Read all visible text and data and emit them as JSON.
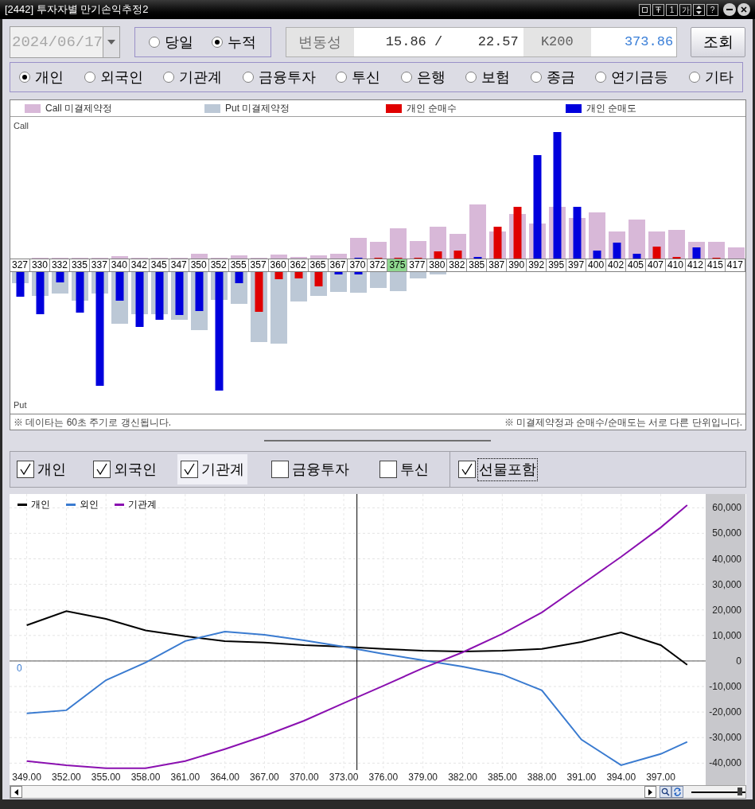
{
  "window": {
    "title": "[2442] 투자자별 만기손익추정2",
    "title_buttons": [
      "1",
      "가",
      "?"
    ]
  },
  "query": {
    "date": {
      "value": "2024/06/17",
      "disabled": true
    },
    "period_options": [
      {
        "label": "당일",
        "selected": false
      },
      {
        "label": "누적",
        "selected": true
      }
    ],
    "volatility_label": "변동성",
    "volatility_value_1": "15.86 /",
    "volatility_value_2": "22.57",
    "index_label": "K200",
    "index_value": "373.86",
    "search_button": "조회"
  },
  "investors": [
    {
      "label": "개인",
      "selected": true
    },
    {
      "label": "외국인",
      "selected": false
    },
    {
      "label": "기관계",
      "selected": false
    },
    {
      "label": "금융투자",
      "selected": false
    },
    {
      "label": "투신",
      "selected": false
    },
    {
      "label": "은행",
      "selected": false
    },
    {
      "label": "보험",
      "selected": false
    },
    {
      "label": "종금",
      "selected": false
    },
    {
      "label": "연기금등",
      "selected": false
    },
    {
      "label": "기타",
      "selected": false
    }
  ],
  "option_chart": {
    "legend": [
      {
        "label": "Call 미결제약정",
        "color": "#d8b8d8"
      },
      {
        "label": "Put 미결제약정",
        "color": "#bcc8d6"
      },
      {
        "label": "개인 순매수",
        "color": "#e00000"
      },
      {
        "label": "개인 순매도",
        "color": "#0000dd"
      }
    ],
    "call_label": "Call",
    "put_label": "Put",
    "strikes": [
      {
        "label": "327",
        "selected": false
      },
      {
        "label": "330",
        "selected": false
      },
      {
        "label": "332",
        "selected": false
      },
      {
        "label": "335",
        "selected": false
      },
      {
        "label": "337",
        "selected": false
      },
      {
        "label": "340",
        "selected": false
      },
      {
        "label": "342",
        "selected": false
      },
      {
        "label": "345",
        "selected": false
      },
      {
        "label": "347",
        "selected": false
      },
      {
        "label": "350",
        "selected": false
      },
      {
        "label": "352",
        "selected": false
      },
      {
        "label": "355",
        "selected": false
      },
      {
        "label": "357",
        "selected": false
      },
      {
        "label": "360",
        "selected": false
      },
      {
        "label": "362",
        "selected": false
      },
      {
        "label": "365",
        "selected": false
      },
      {
        "label": "367",
        "selected": false
      },
      {
        "label": "370",
        "selected": false
      },
      {
        "label": "372",
        "selected": false
      },
      {
        "label": "375",
        "selected": true
      },
      {
        "label": "377",
        "selected": false
      },
      {
        "label": "380",
        "selected": false
      },
      {
        "label": "382",
        "selected": false
      },
      {
        "label": "385",
        "selected": false
      },
      {
        "label": "387",
        "selected": false
      },
      {
        "label": "390",
        "selected": false
      },
      {
        "label": "392",
        "selected": false
      },
      {
        "label": "395",
        "selected": false
      },
      {
        "label": "397",
        "selected": false
      },
      {
        "label": "400",
        "selected": false
      },
      {
        "label": "402",
        "selected": false
      },
      {
        "label": "405",
        "selected": false
      },
      {
        "label": "407",
        "selected": false
      },
      {
        "label": "410",
        "selected": false
      },
      {
        "label": "412",
        "selected": false
      },
      {
        "label": "415",
        "selected": false
      },
      {
        "label": "417",
        "selected": false
      }
    ],
    "note_left": "※ 데이타는 60초 주기로 갱신됩니다.",
    "note_right": "※ 미결제약정과 순매수/순매도는 서로 다른 단위입니다."
  },
  "series_toggles": [
    {
      "label": "개인",
      "checked": true,
      "highlighted": false
    },
    {
      "label": "외국인",
      "checked": true,
      "highlighted": false
    },
    {
      "label": "기관계",
      "checked": true,
      "highlighted": true
    },
    {
      "label": "금융투자",
      "checked": false,
      "highlighted": false
    },
    {
      "label": "투신",
      "checked": false,
      "highlighted": false
    }
  ],
  "futures_toggle": {
    "label": "선물포함",
    "checked": true,
    "focused": true
  },
  "pnl_chart": {
    "zero_label": "0",
    "chart_data": {
      "type": "line",
      "x": [
        349,
        352,
        355,
        358,
        361,
        364,
        367,
        370,
        373,
        376,
        379,
        382,
        385,
        388,
        391,
        394,
        397,
        399
      ],
      "series": [
        {
          "name": "개인",
          "color": "#000000",
          "values": [
            14000,
            19500,
            16500,
            12000,
            9700,
            7800,
            7200,
            6200,
            5600,
            4700,
            4000,
            3700,
            4000,
            4700,
            7500,
            11200,
            6200,
            -1500
          ]
        },
        {
          "name": "외인",
          "color": "#3a7bd0",
          "values": [
            -20500,
            -19300,
            -7500,
            -600,
            7800,
            11500,
            10300,
            8100,
            5600,
            2800,
            300,
            -2200,
            -5300,
            -11500,
            -30800,
            -40800,
            -36400,
            -31700
          ]
        },
        {
          "name": "기관계",
          "color": "#8a10b0",
          "values": [
            -39200,
            -40800,
            -42000,
            -42000,
            -39200,
            -34500,
            -29300,
            -23400,
            -16500,
            -9700,
            -2800,
            3400,
            10600,
            19000,
            29900,
            40800,
            52300,
            61000
          ]
        }
      ],
      "xticks": [
        {
          "value": 349,
          "label": "349.00"
        },
        {
          "value": 352,
          "label": "352.00"
        },
        {
          "value": 355,
          "label": "355.00"
        },
        {
          "value": 358,
          "label": "358.00"
        },
        {
          "value": 361,
          "label": "361.00"
        },
        {
          "value": 364,
          "label": "364.00"
        },
        {
          "value": 367,
          "label": "367.00"
        },
        {
          "value": 370,
          "label": "370.00"
        },
        {
          "value": 373,
          "label": "373.00"
        },
        {
          "value": 376,
          "label": "376.00"
        },
        {
          "value": 379,
          "label": "379.00"
        },
        {
          "value": 382,
          "label": "382.00"
        },
        {
          "value": 385,
          "label": "385.00"
        },
        {
          "value": 388,
          "label": "388.00"
        },
        {
          "value": 391,
          "label": "391.00"
        },
        {
          "value": 394,
          "label": "394.00"
        },
        {
          "value": 397,
          "label": "397.00"
        }
      ],
      "yticks": [
        {
          "value": 60000,
          "label": "60,000"
        },
        {
          "value": 50000,
          "label": "50,000"
        },
        {
          "value": 40000,
          "label": "40,000"
        },
        {
          "value": 30000,
          "label": "30,000"
        },
        {
          "value": 20000,
          "label": "20,000"
        },
        {
          "value": 10000,
          "label": "10,000"
        },
        {
          "value": 0,
          "label": "0"
        },
        {
          "value": -10000,
          "label": "-10,000"
        },
        {
          "value": -20000,
          "label": "-20,000"
        },
        {
          "value": -30000,
          "label": "-30,000"
        },
        {
          "value": -40000,
          "label": "-40,000"
        }
      ],
      "xlim": [
        347.7,
        400.4
      ],
      "ylim": [
        -42700,
        65400
      ],
      "grid": true,
      "legend": true,
      "ref_lines": [
        {
          "axis": "x",
          "value": 374
        }
      ]
    }
  },
  "zoom_slider": {
    "level": 0.93
  }
}
